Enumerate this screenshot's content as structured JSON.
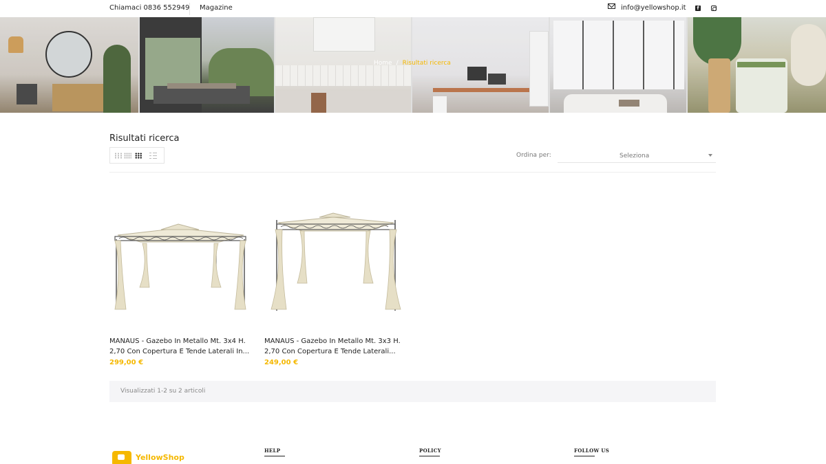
{
  "topbar": {
    "phone": "Chiamaci 0836 552949",
    "magazine": "Magazine",
    "email": "info@yellowshop.it",
    "icons": [
      "mail-icon",
      "facebook-icon",
      "instagram-icon"
    ]
  },
  "breadcrumb": {
    "home": "Home",
    "separator": "/",
    "current": "Risultati ricerca"
  },
  "page": {
    "title": "Risultati ricerca"
  },
  "toolbar": {
    "view_modes": [
      "grid-2",
      "grid-3",
      "grid-4",
      "list"
    ],
    "active_view": "grid-4",
    "sort_label": "Ordina per:",
    "sort_value": "Seleziona"
  },
  "products": [
    {
      "name": "MANAUS - Gazebo In Metallo Mt. 3x4 H. 2,70 Con Copertura E Tende Laterali In...",
      "price": "299,00 €"
    },
    {
      "name": "MANAUS - Gazebo In Metallo Mt. 3x3 H. 2,70 Con Copertura E Tende Laterali...",
      "price": "249,00 €"
    }
  ],
  "results": {
    "summary": "Visualizzati 1-2 su 2 articoli"
  },
  "footer": {
    "logo_text": "YellowShop",
    "help": "HELP",
    "policy": "POLICY",
    "follow_us": "FOLLOW US"
  },
  "colors": {
    "accent": "#f5b800",
    "text": "#222222",
    "muted": "#777777"
  }
}
